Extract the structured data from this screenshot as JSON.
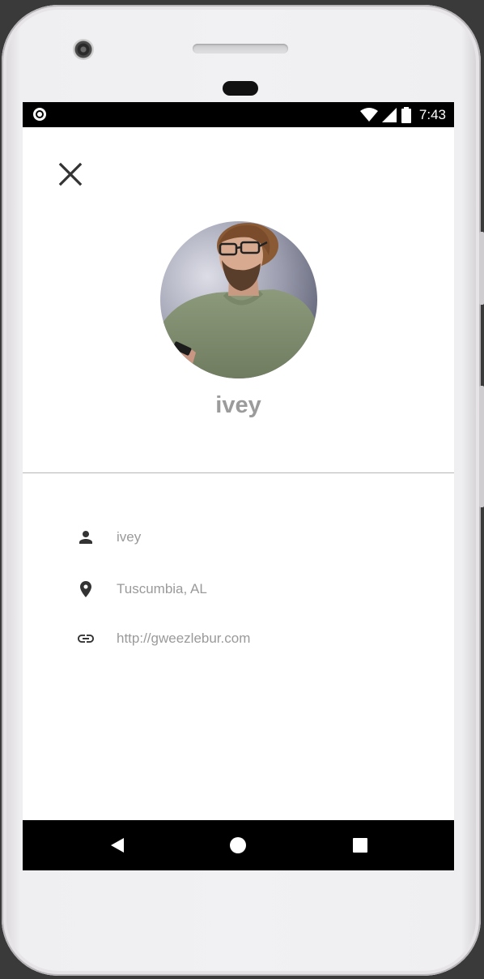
{
  "status_bar": {
    "time": "7:43",
    "icons": [
      "notification-circle-icon",
      "wifi-icon",
      "cell-signal-icon",
      "battery-icon"
    ]
  },
  "profile": {
    "username": "ivey",
    "avatar_alt": "profile photo"
  },
  "details": [
    {
      "icon": "person-icon",
      "text": "ivey"
    },
    {
      "icon": "location-pin-icon",
      "text": "Tuscumbia, AL"
    },
    {
      "icon": "link-icon",
      "text": "http://gweezlebur.com"
    }
  ],
  "nav_bar": {
    "buttons": [
      "back-icon",
      "home-icon",
      "recents-icon"
    ]
  },
  "colors": {
    "name_text": "#9b9b9b",
    "detail_text": "#9a9a9a",
    "icon": "#333333",
    "bars": "#000000"
  }
}
